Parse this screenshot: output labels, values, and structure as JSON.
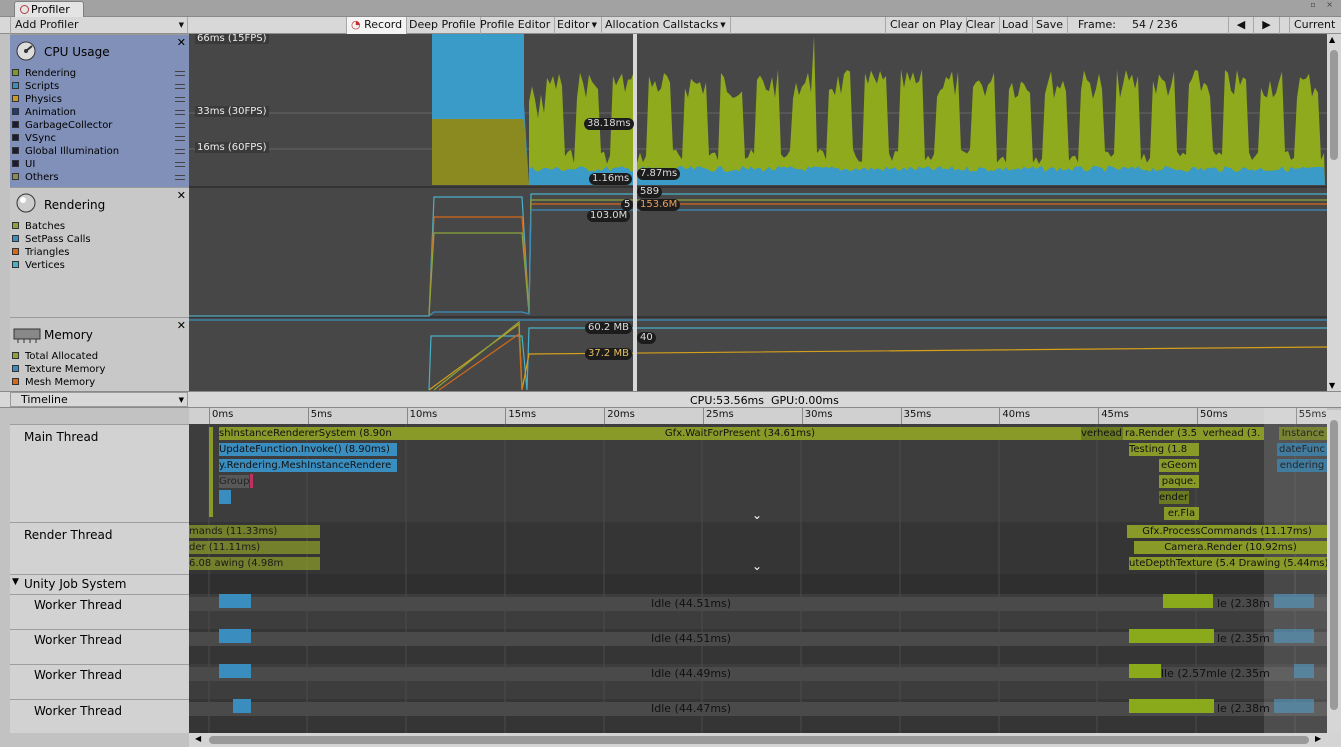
{
  "window": {
    "tab_title": "Profiler"
  },
  "toolbar": {
    "add_profiler": "Add Profiler",
    "record": "Record",
    "deep_profile": "Deep Profile",
    "profile_editor": "Profile Editor",
    "editor": "Editor",
    "allocation_callstacks": "Allocation Callstacks",
    "clear_on_play": "Clear on Play",
    "clear": "Clear",
    "load": "Load",
    "save": "Save",
    "frame_label": "Frame:",
    "frame_value": "54 / 236",
    "current": "Current"
  },
  "modules": [
    {
      "title": "CPU Usage",
      "items": [
        {
          "name": "Rendering",
          "color": "#7f9a26"
        },
        {
          "name": "Scripts",
          "color": "#3a8ebf"
        },
        {
          "name": "Physics",
          "color": "#c79a2b"
        },
        {
          "name": "Animation",
          "color": "#1f3a7a"
        },
        {
          "name": "GarbageCollector",
          "color": "#1a1a3a"
        },
        {
          "name": "VSync",
          "color": "#1a1a3a"
        },
        {
          "name": "Global Illumination",
          "color": "#1a1a3a"
        },
        {
          "name": "UI",
          "color": "#1a1a3a"
        },
        {
          "name": "Others",
          "color": "#8a8a5a"
        }
      ]
    },
    {
      "title": "Rendering",
      "items": [
        {
          "name": "Batches",
          "color": "#8aa43a"
        },
        {
          "name": "SetPass Calls",
          "color": "#3a8ebf"
        },
        {
          "name": "Triangles",
          "color": "#d46a1a"
        },
        {
          "name": "Vertices",
          "color": "#4ab0c8"
        }
      ]
    },
    {
      "title": "Memory",
      "items": [
        {
          "name": "Total Allocated",
          "color": "#8aa43a"
        },
        {
          "name": "Texture Memory",
          "color": "#3a8ebf"
        },
        {
          "name": "Mesh Memory",
          "color": "#d46a1a"
        }
      ]
    }
  ],
  "cpu_graph": {
    "y_labels": [
      "66ms (15FPS)",
      "33ms (30FPS)",
      "16ms (60FPS)"
    ],
    "value_labels": [
      "38.18ms",
      "7.87ms",
      "1.16ms"
    ],
    "colors": {
      "rendering": "#8faa1c",
      "scripts": "#3a9ac8",
      "others": "#8a8a20"
    }
  },
  "rendering_graph": {
    "value_labels": [
      "589",
      "5",
      "153.6M",
      "103.0M"
    ]
  },
  "memory_graph": {
    "value_labels": [
      "60.2 MB",
      "40",
      "37.2 MB"
    ]
  },
  "timeline": {
    "view": "Timeline",
    "cpu": "CPU:53.56ms",
    "gpu": "GPU:0.00ms",
    "ticks": [
      "0ms",
      "5ms",
      "10ms",
      "15ms",
      "20ms",
      "25ms",
      "30ms",
      "35ms",
      "40ms",
      "45ms",
      "50ms",
      "55ms"
    ],
    "threads": [
      "Main Thread",
      "Render Thread",
      "Unity Job System",
      "Worker Thread",
      "Worker Thread",
      "Worker Thread",
      "Worker Thread"
    ],
    "main_bars": [
      "shInstanceRendererSystem (8.90n",
      "Gfx.WaitForPresent (34.61ms)",
      "UpdateFunction.Invoke() (8.90ms)",
      "y.Rendering.MeshInstanceRendere",
      "verhead (",
      "ra.Render (3.5",
      "verhead (3.",
      "Instance",
      "Testing (1.8",
      "eGeom",
      "dateFunc",
      "endering",
      "paque.",
      "enderL",
      "Group",
      "er.Fla"
    ],
    "render_bars": [
      "mands (11.33ms)",
      "der (11.11ms)",
      "6.08 awing (4.98m",
      "Gfx.ProcessCommands (11.17ms)",
      "Camera.Render (10.92ms)",
      "uteDepthTexture (5.4 Drawing (5.44ms)"
    ],
    "worker_idle": [
      "Idle (44.51ms)",
      "Idle (44.51ms)",
      "Idle (44.49ms)",
      "Idle (44.47ms)"
    ],
    "worker_tail": [
      "le (2.38m",
      "le (2.35m",
      "lle (2.57m",
      "le (2.35m",
      "le (2.38m"
    ]
  }
}
